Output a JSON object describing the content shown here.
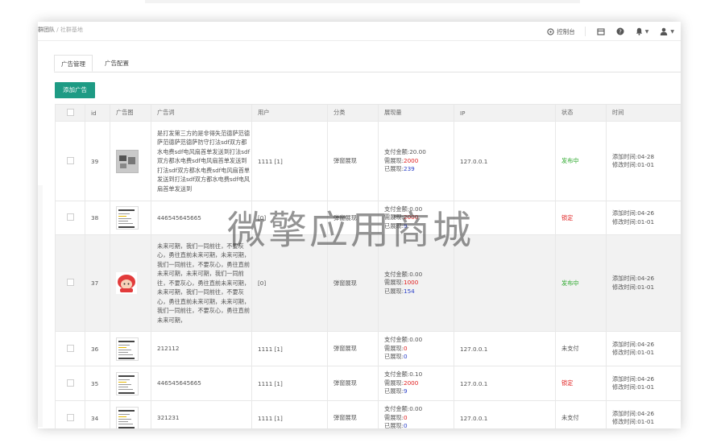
{
  "header": {
    "breadcrumb_current": "群团队",
    "breadcrumb_sep": "/",
    "breadcrumb_next": "社群基地",
    "console_label": "控制台"
  },
  "tabs": [
    {
      "label": "广告管理",
      "active": true
    },
    {
      "label": "广告配置",
      "active": false
    }
  ],
  "add_button": "添加广告",
  "columns": [
    "id",
    "广告图",
    "广告词",
    "用户",
    "分类",
    "展现量",
    "IP",
    "状态",
    "时间"
  ],
  "stat_labels": {
    "pay": "支付金额:",
    "need": "需展现:",
    "shown": "已展现:"
  },
  "time_labels": {
    "added": "添加时间:",
    "modified": "修改时间:"
  },
  "rows": [
    {
      "id": "39",
      "thumb": "photo",
      "text": "是打发第三方的是非得失范德萨范德萨范德萨范德萨防守打法sdf双方都水电费sdf电风扇首单发送到打法sdf双方都水电费sdf电风扇首单发送到打法sdf双方都水电费sdf电风扇首单发送到打法sdf双方都水电费sdf电风扇首单发送到",
      "user": "1111 [1]",
      "category": "弹窗展现",
      "pay": "20.00",
      "need": "2000",
      "shown": "239",
      "ip": "127.0.0.1",
      "status": "发布中",
      "status_type": "on",
      "added": "04-28",
      "modified": "01-01"
    },
    {
      "id": "38",
      "thumb": "screen",
      "text": "446545645665",
      "user": "[0]",
      "category": "弹窗展现",
      "pay": "0.00",
      "need": "2000",
      "shown": "9",
      "ip": "",
      "status": "锁定",
      "status_type": "lock",
      "added": "04-26",
      "modified": "01-01"
    },
    {
      "id": "37",
      "thumb": "char",
      "text": "未来可期，我们一同前往，不要灰心，勇往直前未来可期，未来可期，我们一同前往，不要灰心，勇往直前未来可期，未来可期，我们一同前往，不要灰心，勇往直前未来可期，未来可期，我们一同前往，不要灰心，勇往直前未来可期，未来可期，我们一同前往，不要灰心，勇往直前未来可期，",
      "user": "[0]",
      "category": "弹窗展现",
      "pay": "0.00",
      "need": "1000",
      "shown": "154",
      "ip": "",
      "status": "发布中",
      "status_type": "on",
      "added": "04-26",
      "modified": "01-01"
    },
    {
      "id": "36",
      "thumb": "screen",
      "text": "212112",
      "user": "1111 [1]",
      "category": "弹窗展现",
      "pay": "0.00",
      "need": "0",
      "shown": "0",
      "ip": "127.0.0.1",
      "status": "未支付",
      "status_type": "unpaid",
      "added": "04-26",
      "modified": "01-01"
    },
    {
      "id": "35",
      "thumb": "screen",
      "text": "446545645665",
      "user": "1111 [1]",
      "category": "弹窗展现",
      "pay": "0.10",
      "need": "2000",
      "shown": "9",
      "ip": "127.0.0.1",
      "status": "锁定",
      "status_type": "lock",
      "added": "04-26",
      "modified": "01-01"
    },
    {
      "id": "34",
      "thumb": "screen",
      "text": "321231",
      "user": "1111 [1]",
      "category": "弹窗展现",
      "pay": "0.00",
      "need": "0",
      "shown": "0",
      "ip": "127.0.0.1",
      "status": "未支付",
      "status_type": "unpaid",
      "added": "04-26",
      "modified": "01-01"
    }
  ],
  "watermark": "微擎应用商城",
  "colors": {
    "primary": "#1e9b84",
    "red": "#e02020",
    "green": "#2ea92e",
    "blue": "#2a3fc8"
  }
}
